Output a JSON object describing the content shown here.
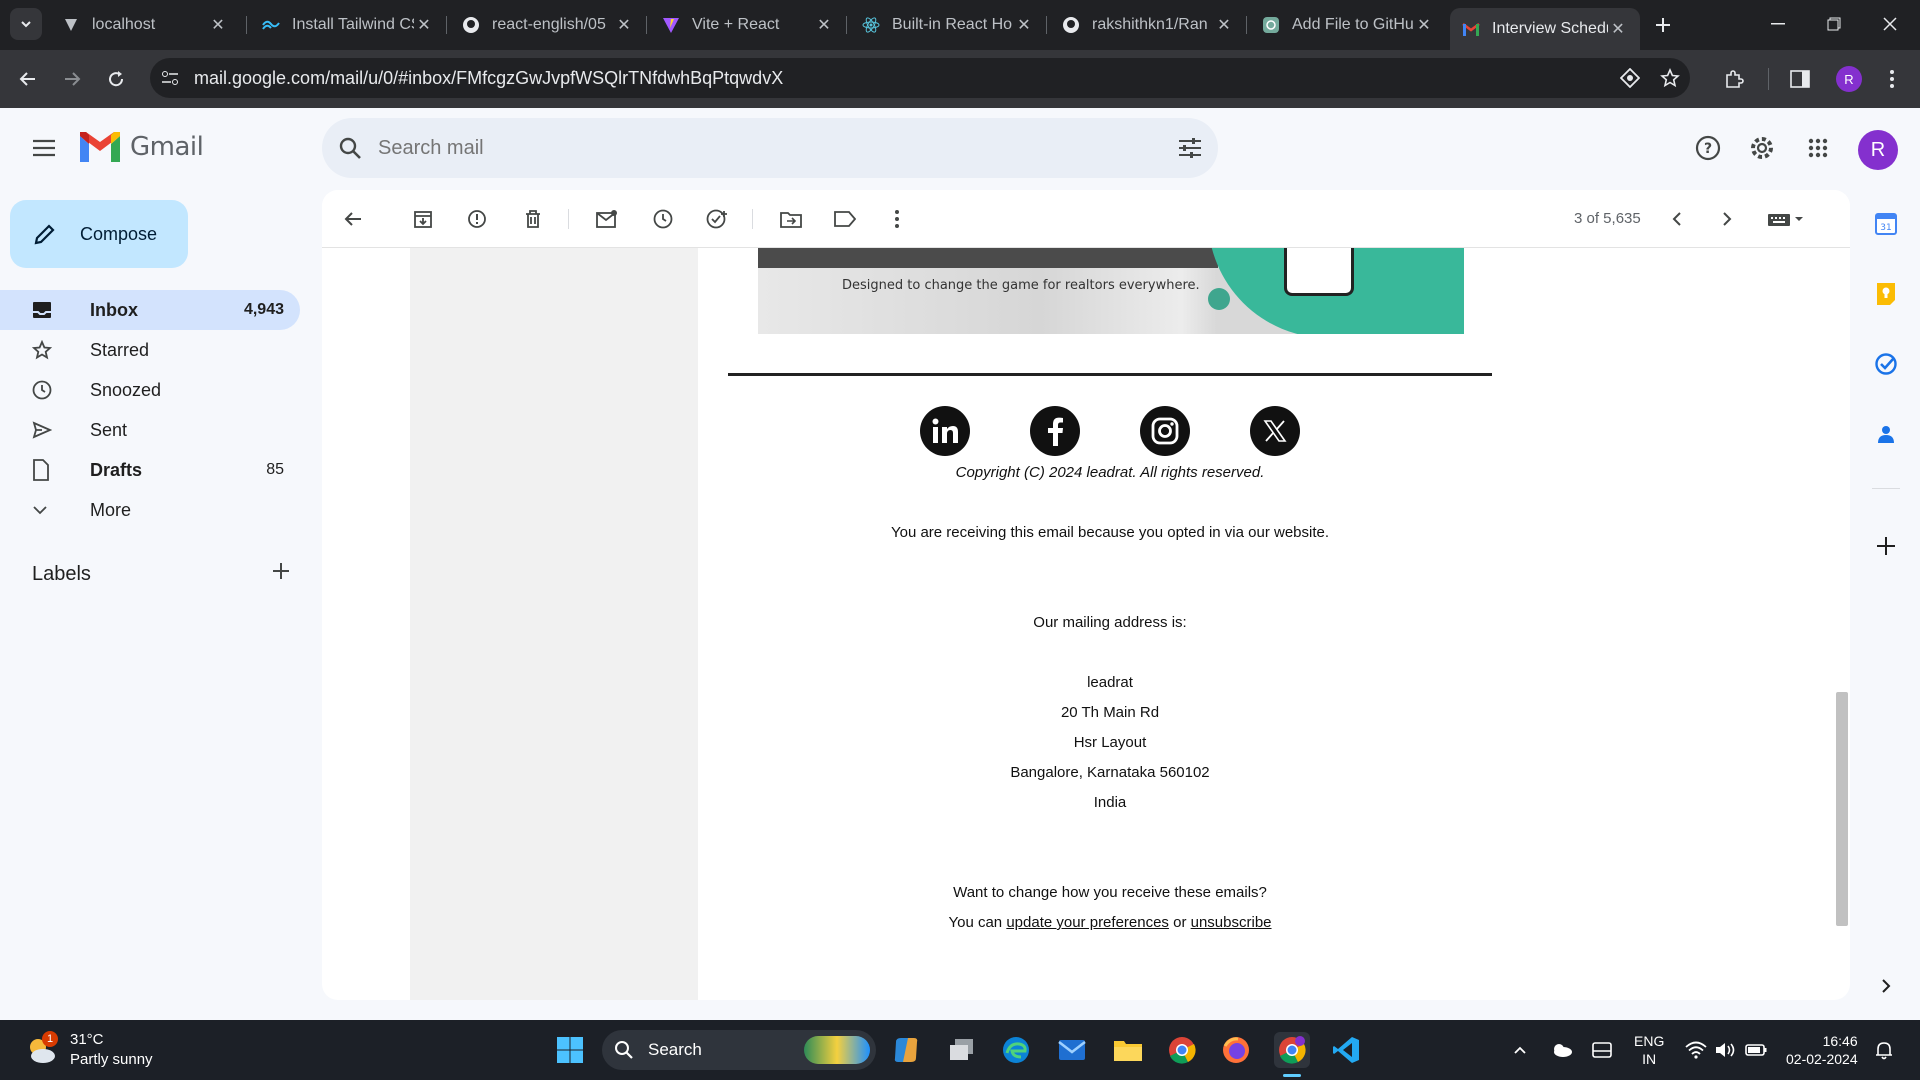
{
  "browser": {
    "tabs": [
      {
        "title": "localhost",
        "icon": "vercel-icon"
      },
      {
        "title": "Install Tailwind CSS",
        "icon": "tailwind-icon"
      },
      {
        "title": "react-english/05",
        "icon": "github-icon"
      },
      {
        "title": "Vite + React",
        "icon": "vite-icon"
      },
      {
        "title": "Built-in React Ho",
        "icon": "react-icon"
      },
      {
        "title": "rakshithkn1/Ran",
        "icon": "github-icon"
      },
      {
        "title": "Add File to GitHu",
        "icon": "chatgpt-icon"
      },
      {
        "title": "Interview Schedu",
        "icon": "gmail-icon"
      }
    ],
    "url": "mail.google.com/mail/u/0/#inbox/FMfcgzGwJvpfWSQlrTNfdwhBqPtqwdvX",
    "profile_initial": "R"
  },
  "gmail": {
    "logo_text": "Gmail",
    "search_placeholder": "Search mail",
    "avatar_initial": "R",
    "compose_label": "Compose",
    "nav": [
      {
        "label": "Inbox",
        "count": "4,943",
        "icon": "inbox-icon"
      },
      {
        "label": "Starred",
        "count": "",
        "icon": "star-icon"
      },
      {
        "label": "Snoozed",
        "count": "",
        "icon": "clock-icon"
      },
      {
        "label": "Sent",
        "count": "",
        "icon": "send-icon"
      },
      {
        "label": "Drafts",
        "count": "85",
        "icon": "draft-icon"
      },
      {
        "label": "More",
        "count": "",
        "icon": "chevron-down-icon"
      }
    ],
    "labels_heading": "Labels",
    "pager": "3 of 5,635"
  },
  "email": {
    "banner_tagline": "Designed to change the game for realtors everywhere.",
    "copyright": "Copyright (C) 2024 leadrat. All rights reserved.",
    "reason": "You are receiving this email because you opted in via our website.",
    "mailing_heading": "Our mailing address is:",
    "address": [
      "leadrat",
      "20 Th Main Rd",
      "Hsr Layout",
      "Bangalore, Karnataka 560102",
      "India"
    ],
    "change_q": "Want to change how you receive these emails?",
    "you_can": "You can",
    "update_prefs": "update your preferences",
    "or": "or",
    "unsubscribe": "unsubscribe",
    "socials": [
      "linkedin-icon",
      "facebook-icon",
      "instagram-icon",
      "x-icon"
    ]
  },
  "taskbar": {
    "temp": "31°C",
    "weather": "Partly sunny",
    "weather_badge": "1",
    "search_label": "Search",
    "lang_top": "ENG",
    "lang_bottom": "IN",
    "time": "16:46",
    "date": "02-02-2024"
  },
  "colors": {
    "accent": "#0b57d0",
    "compose_bg": "#c2e7ff",
    "nav_active_bg": "#d3e3fd",
    "avatar": "#8430ce"
  }
}
